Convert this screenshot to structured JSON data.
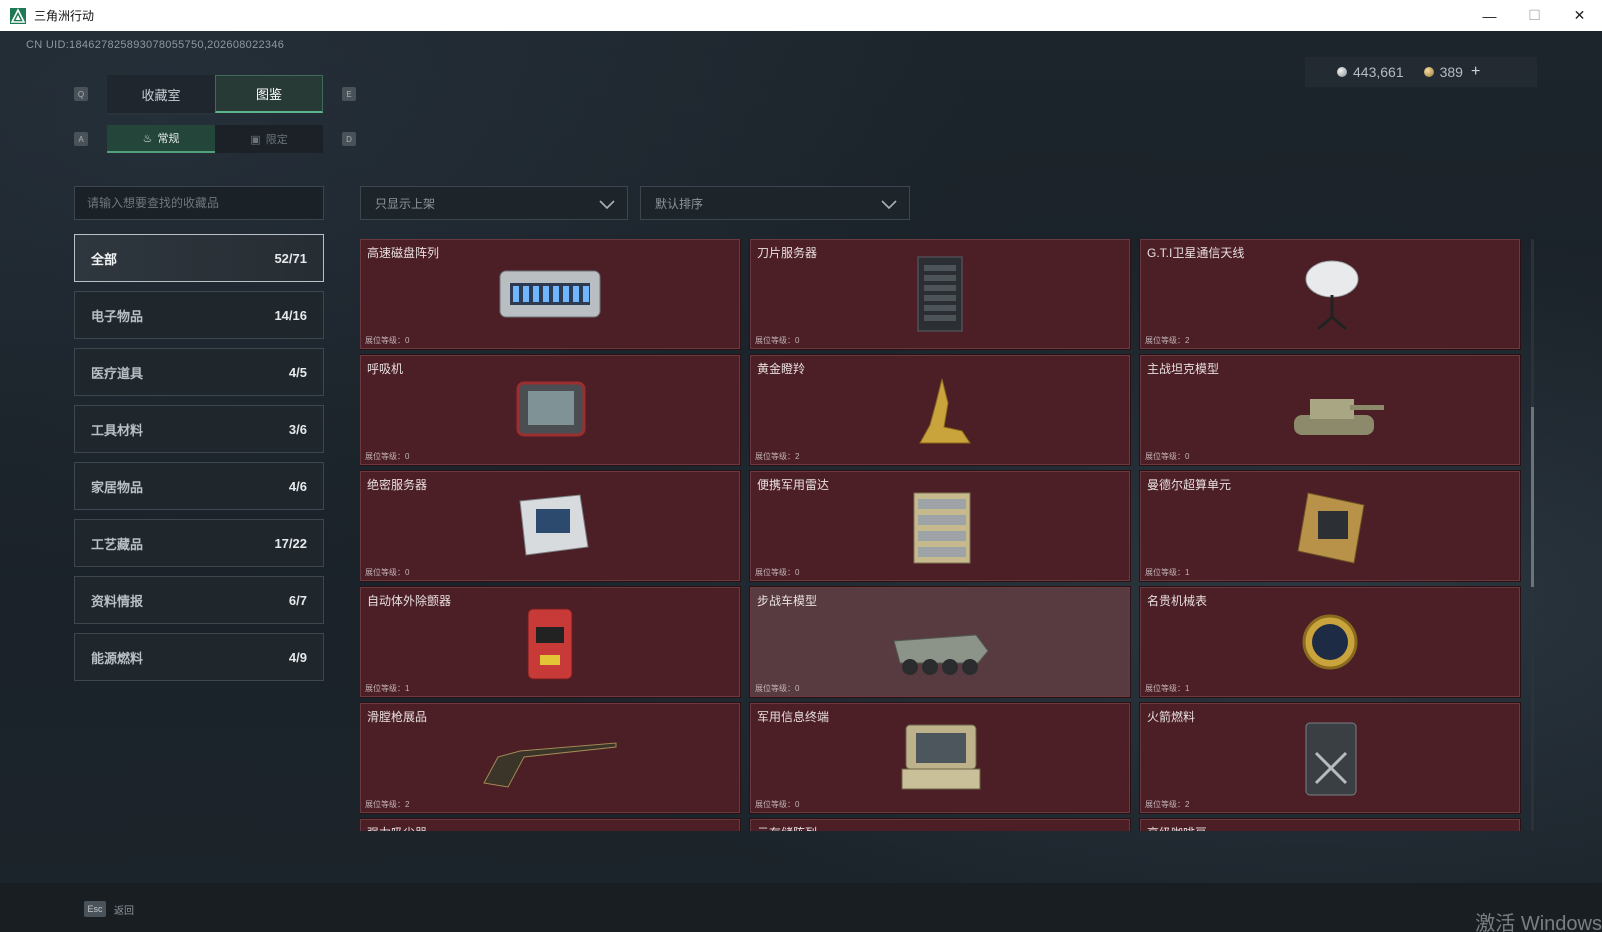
{
  "window": {
    "title": "三角洲行动",
    "minimize": "—",
    "maximize": "☐",
    "close": "✕"
  },
  "uid": "CN UID:1846278258930780557​50,202608022346",
  "currency": {
    "silver": "443,661",
    "gold": "389",
    "plus": "+"
  },
  "keys": {
    "q": "Q",
    "e": "E",
    "a": "A",
    "d": "D"
  },
  "tabs": {
    "collection": "收藏室",
    "catalog": "图鉴"
  },
  "subtabs": {
    "regular": "常规",
    "limited": "限定"
  },
  "search": {
    "placeholder": "请输入想要查找的收藏品"
  },
  "filters": {
    "listed": "只显示上架",
    "sort": "默认排序"
  },
  "categories": [
    {
      "label": "全部",
      "count": "52/71"
    },
    {
      "label": "电子物品",
      "count": "14/16"
    },
    {
      "label": "医疗道具",
      "count": "4/5"
    },
    {
      "label": "工具材料",
      "count": "3/6"
    },
    {
      "label": "家居物品",
      "count": "4/6"
    },
    {
      "label": "工艺藏品",
      "count": "17/22"
    },
    {
      "label": "资料情报",
      "count": "6/7"
    },
    {
      "label": "能源燃料",
      "count": "4/9"
    }
  ],
  "items": [
    {
      "name": "高速磁盘阵列",
      "level": "展位等级：0",
      "icon": "disk-array-icon"
    },
    {
      "name": "刀片服务器",
      "level": "展位等级：0",
      "icon": "blade-server-icon"
    },
    {
      "name": "G.T.I卫星通信天线",
      "level": "展位等级：2",
      "icon": "satellite-antenna-icon"
    },
    {
      "name": "呼吸机",
      "level": "展位等级：0",
      "icon": "ventilator-icon"
    },
    {
      "name": "黄金瞪羚",
      "level": "展位等级：2",
      "icon": "golden-gazelle-icon"
    },
    {
      "name": "主战坦克模型",
      "level": "展位等级：0",
      "icon": "tank-model-icon"
    },
    {
      "name": "绝密服务器",
      "level": "展位等级：0",
      "icon": "secret-server-icon"
    },
    {
      "name": "便携军用雷达",
      "level": "展位等级：0",
      "icon": "portable-radar-icon"
    },
    {
      "name": "曼德尔超算单元",
      "level": "展位等级：1",
      "icon": "compute-unit-icon"
    },
    {
      "name": "自动体外除颤器",
      "level": "展位等级：1",
      "icon": "defibrillator-icon"
    },
    {
      "name": "步战车模型",
      "level": "展位等级：0",
      "icon": "ifv-model-icon"
    },
    {
      "name": "名贵机械表",
      "level": "展位等级：1",
      "icon": "luxury-watch-icon"
    },
    {
      "name": "滑膛枪展品",
      "level": "展位等级：2",
      "icon": "musket-icon"
    },
    {
      "name": "军用信息终端",
      "level": "展位等级：0",
      "icon": "military-terminal-icon"
    },
    {
      "name": "火箭燃料",
      "level": "展位等级：2",
      "icon": "rocket-fuel-icon"
    },
    {
      "name": "强力吸尘器",
      "level": "",
      "icon": "vacuum-icon"
    },
    {
      "name": "云存储阵列",
      "level": "",
      "icon": "cloud-storage-icon"
    },
    {
      "name": "高级咖啡豆",
      "level": "",
      "icon": "coffee-beans-icon"
    }
  ],
  "footer": {
    "esc_key": "Esc",
    "esc_label": "返回"
  },
  "watermark": "激活 Windows",
  "colors": {
    "card_bg": "#4b1f25",
    "accent_green": "#5fb58b"
  }
}
